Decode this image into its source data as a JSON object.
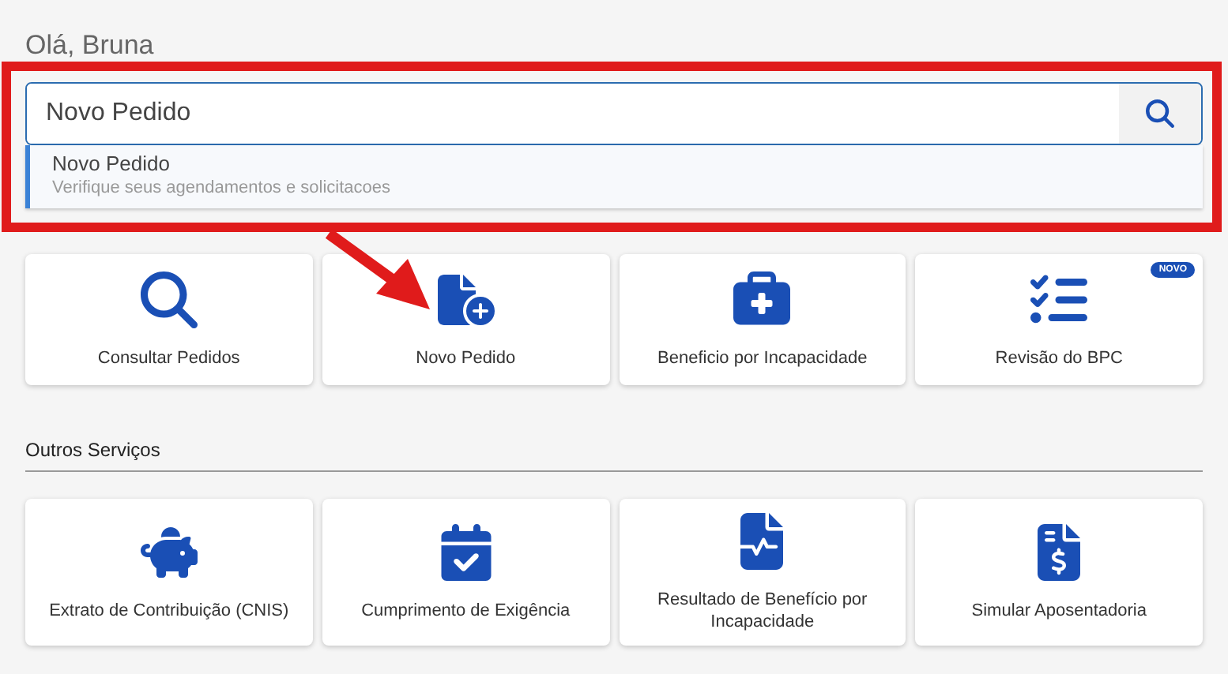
{
  "greeting": "Olá, Bruna",
  "search": {
    "value": "Novo Pedido"
  },
  "suggestions": [
    {
      "title": "Novo Pedido",
      "subtitle": "Verifique seus agendamentos e solicitacoes"
    }
  ],
  "sections": [
    {
      "cards": [
        {
          "label": "Consultar Pedidos",
          "kind": "search"
        },
        {
          "label": "Novo Pedido",
          "kind": "new"
        },
        {
          "label": "Beneficio por Incapacidade",
          "kind": "medical"
        },
        {
          "label": "Revisão do BPC",
          "kind": "review",
          "badge": "NOVO"
        }
      ]
    },
    {
      "title": "Outros Serviços",
      "cards": [
        {
          "label": "Extrato de Contribuição (CNIS)",
          "kind": "savings"
        },
        {
          "label": "Cumprimento de Exigência",
          "kind": "task"
        },
        {
          "label": "Resultado de Benefício por Incapacidade",
          "kind": "result"
        },
        {
          "label": "Simular Aposentadoria",
          "kind": "money"
        }
      ]
    }
  ]
}
